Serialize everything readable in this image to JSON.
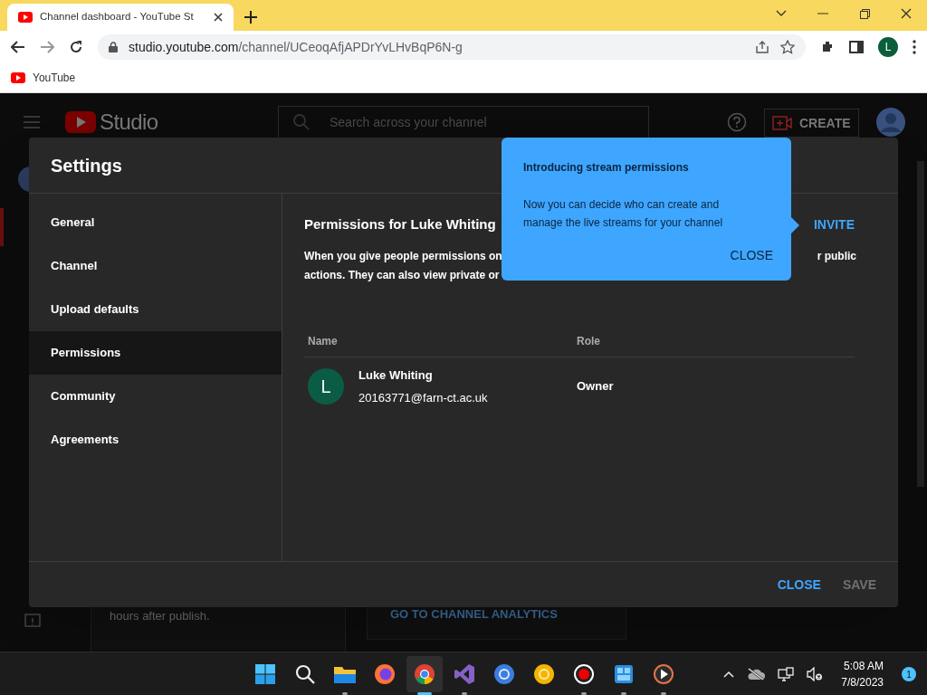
{
  "browser": {
    "tab_title": "Channel dashboard - YouTube St",
    "url_host": "studio.youtube.com",
    "url_path": "/channel/UCeoqAfjAPDrYvLHvBqP6N-g",
    "profile_initial": "L",
    "bookmarks": [
      "YouTube"
    ]
  },
  "studio_header": {
    "logo": "Studio",
    "search": {
      "placeholder": "Search across your channel"
    },
    "create": "CREATE"
  },
  "background_cards": [
    "hours after publish.",
    "GO TO CHANNEL ANALYTICS"
  ],
  "settings": {
    "title": "Settings",
    "nav": [
      {
        "label": "General",
        "selected": false
      },
      {
        "label": "Channel",
        "selected": false
      },
      {
        "label": "Upload defaults",
        "selected": false
      },
      {
        "label": "Permissions",
        "selected": true
      },
      {
        "label": "Community",
        "selected": false
      },
      {
        "label": "Agreements",
        "selected": false
      }
    ],
    "heading": "Permissions for Luke Whiting",
    "invite": "INVITE",
    "description_lines": [
      {
        "left": "When you give people permissions on",
        "right": "r public"
      },
      {
        "left": "actions. They can also view private or"
      }
    ],
    "table": {
      "columns": [
        "Name",
        "Role"
      ],
      "rows": [
        {
          "initial": "L",
          "name": "Luke Whiting",
          "email": "20163771@farn-ct.ac.uk",
          "role": "Owner"
        }
      ]
    },
    "footer": [
      {
        "label": "CLOSE",
        "disabled": false
      },
      {
        "label": "SAVE",
        "disabled": true
      }
    ]
  },
  "tooltip": {
    "title": "Introducing stream permissions",
    "body": "Now you can decide who can create and manage the live streams for your channel",
    "close": "CLOSE"
  },
  "taskbar": {
    "apps": [
      {
        "kind": "windows",
        "running": false,
        "active": false
      },
      {
        "kind": "search",
        "running": false,
        "active": false
      },
      {
        "kind": "folder",
        "running": true,
        "active": false
      },
      {
        "kind": "firefox",
        "running": false,
        "active": false
      },
      {
        "kind": "chrome",
        "running": true,
        "active": true
      },
      {
        "kind": "vs",
        "running": true,
        "active": false
      },
      {
        "kind": "blue-browser",
        "running": false,
        "active": false
      },
      {
        "kind": "yellow-browser",
        "running": false,
        "active": false
      },
      {
        "kind": "record",
        "running": true,
        "active": false
      },
      {
        "kind": "gallery",
        "running": true,
        "active": false
      },
      {
        "kind": "player",
        "running": true,
        "active": false
      }
    ],
    "time": "5:08 AM",
    "date": "7/8/2023",
    "notifications": "1"
  }
}
